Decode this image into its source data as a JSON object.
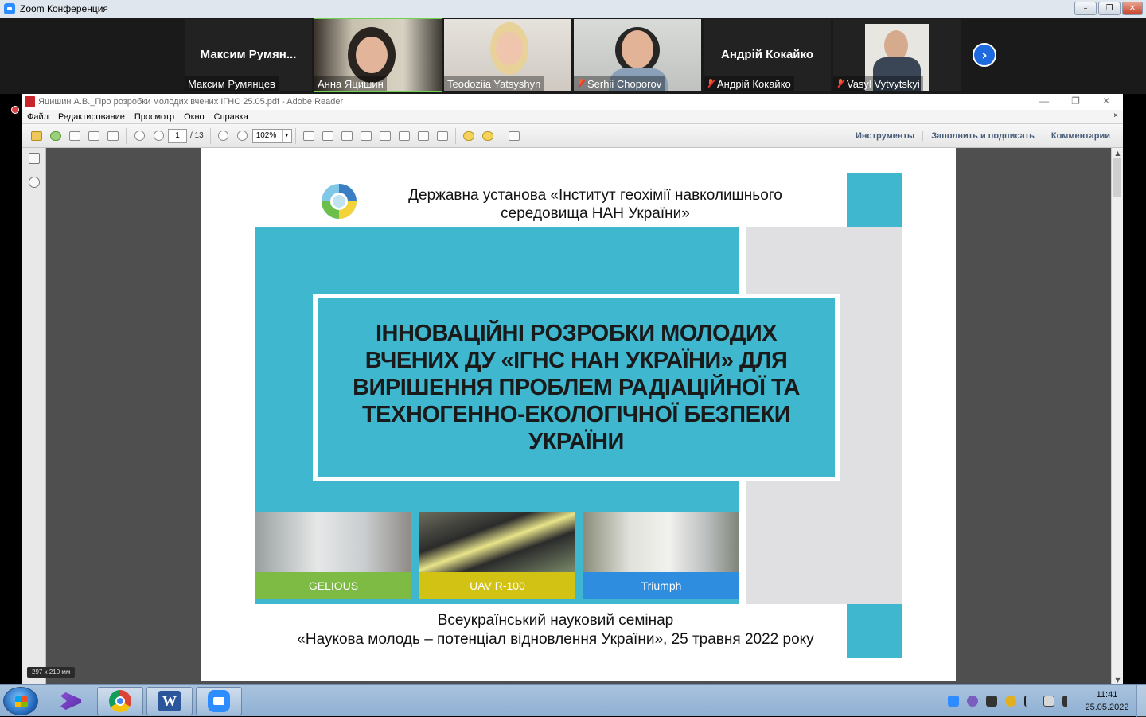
{
  "zoom_window": {
    "title": "Zoom Конференция",
    "controls": [
      "–",
      "❐",
      "✕"
    ]
  },
  "participants": [
    {
      "display": "Максим  Румян...",
      "name": "Максим Румянцев",
      "muted": false,
      "video": false
    },
    {
      "display": "",
      "name": "Анна Яцишин",
      "muted": false,
      "video": true,
      "active": true
    },
    {
      "display": "",
      "name": "Teodoziia Yatsyshyn",
      "muted": false,
      "video": true
    },
    {
      "display": "",
      "name": "Serhii Choporov",
      "muted": true,
      "video": true
    },
    {
      "display": "Андрій Кокайко",
      "name": "Андрій Кокайко",
      "muted": true,
      "video": false
    },
    {
      "display": "",
      "name": "Vasyl Vytvytskyi",
      "muted": true,
      "video": true
    }
  ],
  "next_arrow": "›",
  "reader": {
    "title": "Яцишин А.В._Про розробки молодих вчених ІГНС 25.05.pdf - Adobe Reader",
    "menu": [
      "Файл",
      "Редактирование",
      "Просмотр",
      "Окно",
      "Справка"
    ],
    "menu_close": "×",
    "window_controls": [
      "—",
      "❐",
      "✕"
    ],
    "page_current": "1",
    "page_total": "/ 13",
    "zoom": "102%",
    "right_tools": [
      "Инструменты",
      "Заполнить и подписать",
      "Комментарии"
    ],
    "page_size": "297 x 210 мм"
  },
  "slide": {
    "org_title": "Державна установа «Інститут геохімії навколишнього середовища НАН України»",
    "main_title": "ІННОВАЦІЙНІ РОЗРОБКИ МОЛОДИХ ВЧЕНИХ ДУ «ІГНС НАН УКРАЇНИ» ДЛЯ ВИРІШЕННЯ ПРОБЛЕМ РАДІАЦІЙНОЇ ТА ТЕХНОГЕННО-ЕКОЛОГІЧНОЇ БЕЗПЕКИ УКРАЇНИ",
    "photos": [
      {
        "caption": "GELIOUS",
        "color": "#7dbb45"
      },
      {
        "caption": "UAV R-100",
        "color": "#d2c214"
      },
      {
        "caption": "Triumph",
        "color": "#2f8de0"
      }
    ],
    "seminar_line1": "Всеукраїнський науковий семінар",
    "seminar_line2": "«Наукова молодь – потенціал відновлення України», 25 травня 2022 року",
    "accent_color": "#3fb7cf"
  },
  "taskbar": {
    "time": "11:41",
    "date": "25.05.2022",
    "apps": [
      "start",
      "visual-studio",
      "chrome",
      "word",
      "zoom"
    ]
  }
}
